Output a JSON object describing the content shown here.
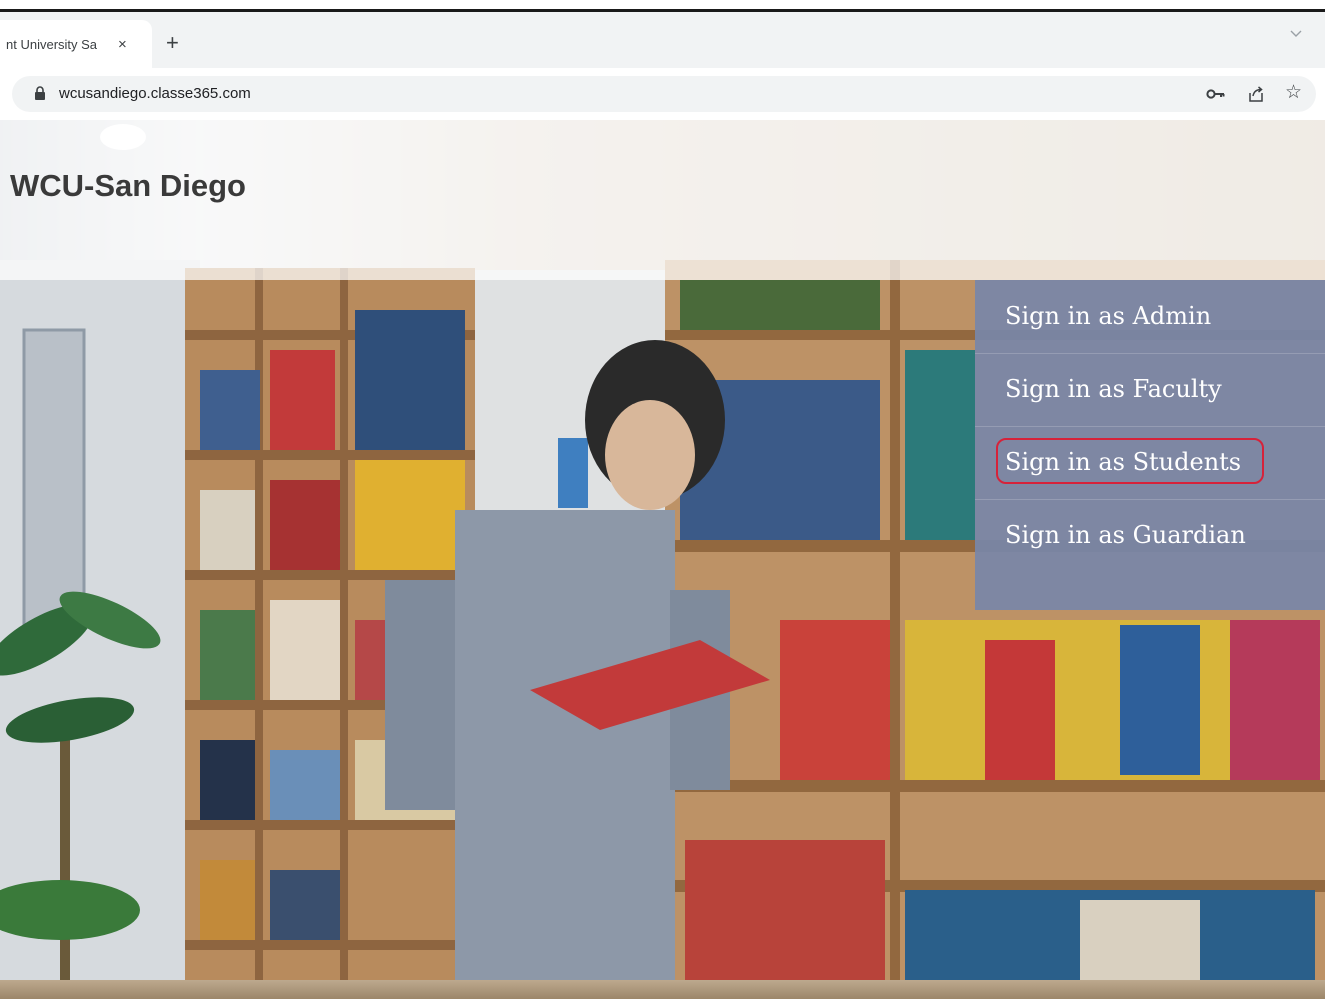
{
  "browser": {
    "tab_title": "nt University Sa",
    "close_glyph": "×",
    "new_tab_glyph": "+",
    "url": "wcusandiego.classe365.com",
    "star_glyph": "☆",
    "icons": [
      "lock-icon",
      "key-icon",
      "share-icon",
      "star-icon",
      "chevron-down-icon"
    ]
  },
  "page": {
    "site_title": "WCU-San Diego",
    "signin_options": [
      {
        "label": "Sign in as Admin"
      },
      {
        "label": "Sign in as Faculty"
      },
      {
        "label": "Sign in as Students",
        "highlighted": true
      },
      {
        "label": "Sign in as Guardian"
      }
    ],
    "colors": {
      "panel": "#7887a8",
      "highlight_ring": "#d6223a",
      "title": "#3a3a3a"
    }
  }
}
